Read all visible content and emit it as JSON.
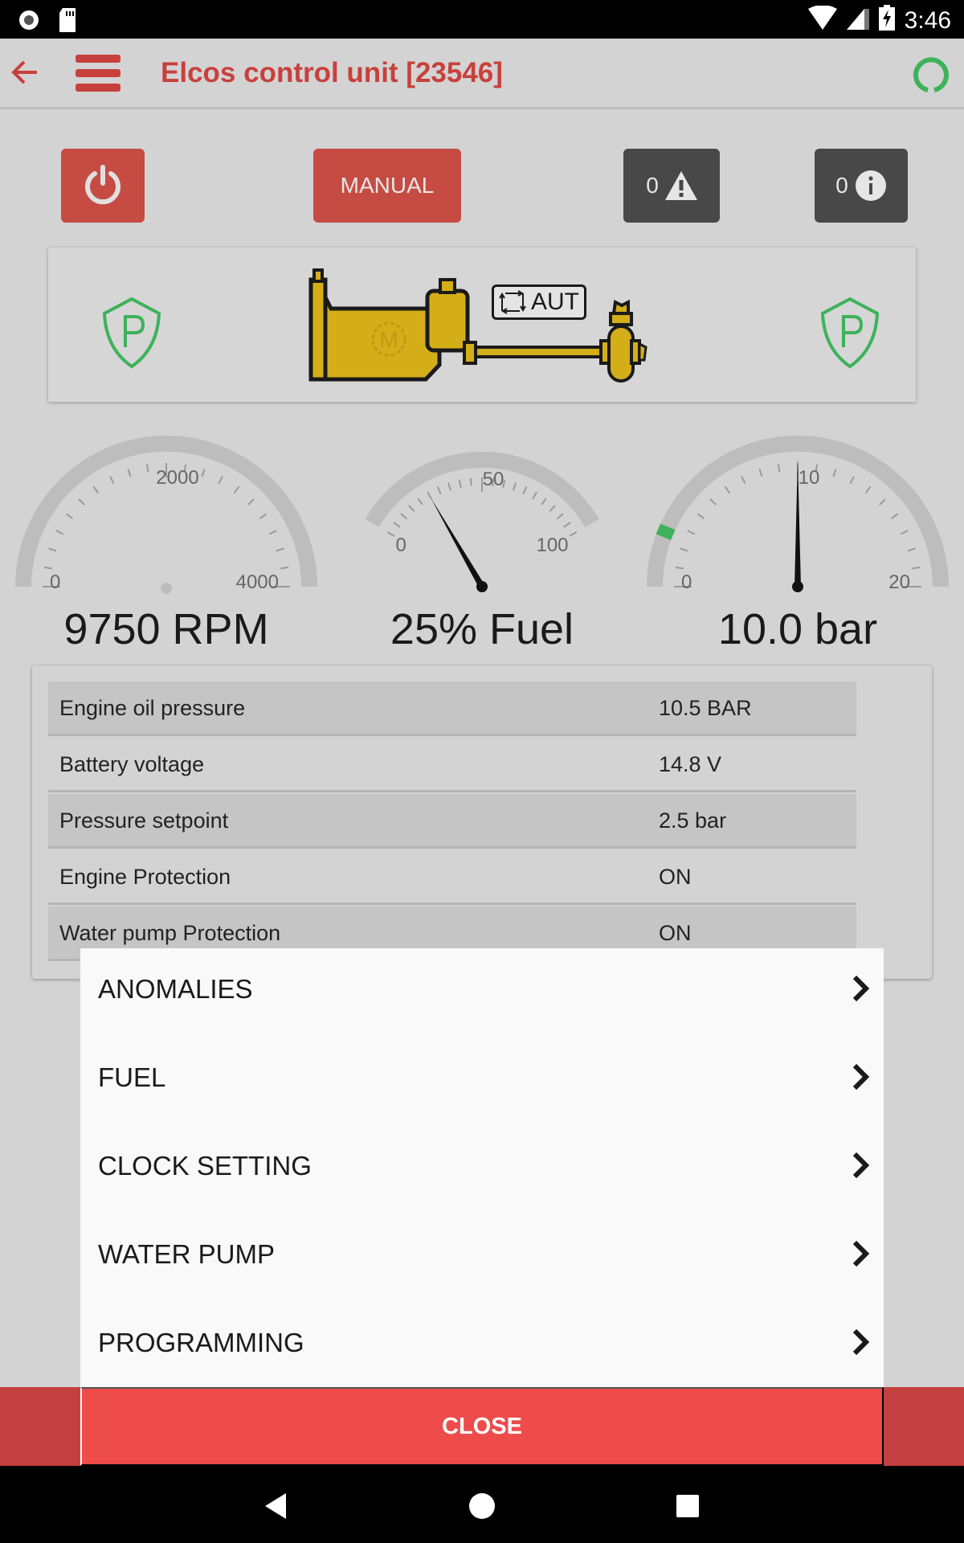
{
  "status_bar": {
    "time": "3:46",
    "icons": [
      "camera-icon",
      "sd-card-icon",
      "wifi-icon",
      "signal-icon",
      "battery-charging-icon"
    ]
  },
  "app_bar": {
    "back_icon": "arrow-left-icon",
    "menu_icon": "hamburger-menu-icon",
    "title": "Elcos control unit [23546]",
    "connection_icon": "connection-status-ring-icon",
    "accent": "#c8403c",
    "connection_color": "#3db25a"
  },
  "controls": {
    "power_icon": "power-icon",
    "mode_label": "MANUAL",
    "alarm_count": "0",
    "alarm_icon": "warning-icon",
    "info_count": "0",
    "info_icon": "info-icon",
    "button_red": "#c64c43",
    "button_dark": "#484848"
  },
  "schema": {
    "left_protection_icon": "shield-p-icon",
    "right_protection_icon": "shield-p-icon",
    "engine_icon": "engine-pump-icon",
    "engine_letter": "M",
    "auto_label": "AUT",
    "auto_icon": "auto-cycle-icon",
    "shield_color": "#3db25a",
    "engine_color": "#d4ae18"
  },
  "gauges": [
    {
      "name": "rpm",
      "min": 0,
      "max": 4000,
      "tick_labels": [
        "0",
        "2000",
        "4000"
      ],
      "value": 9750,
      "needle_visible": false,
      "readout": "9750 RPM",
      "sweep": "half"
    },
    {
      "name": "fuel",
      "min": 0,
      "max": 100,
      "tick_labels": [
        "0",
        "50",
        "100"
      ],
      "value": 25,
      "needle_visible": true,
      "readout": "25% Fuel",
      "sweep": "partial"
    },
    {
      "name": "pressure",
      "min": 0,
      "max": 20,
      "tick_labels": [
        "0",
        "10",
        "20"
      ],
      "value": 10.0,
      "needle_visible": true,
      "marker": 2.5,
      "marker_color": "#3db25a",
      "readout": "10.0 bar",
      "sweep": "half"
    }
  ],
  "table": {
    "rows": [
      {
        "label": "Engine oil pressure",
        "value": "10.5 BAR"
      },
      {
        "label": "Battery voltage",
        "value": "14.8 V"
      },
      {
        "label": "Pressure setpoint",
        "value": "2.5 bar"
      },
      {
        "label": "Engine Protection",
        "value": "ON"
      },
      {
        "label": "Water pump Protection",
        "value": "ON"
      }
    ]
  },
  "sheet": {
    "items": [
      {
        "label": "ANOMALIES"
      },
      {
        "label": "FUEL"
      },
      {
        "label": "CLOCK SETTING"
      },
      {
        "label": "WATER PUMP"
      },
      {
        "label": "PROGRAMMING"
      }
    ],
    "chevron_icon": "chevron-right-icon",
    "close_label": "CLOSE",
    "close_color": "#ee4b4b"
  },
  "nav_bar": {
    "back_icon": "nav-back-icon",
    "home_icon": "nav-home-icon",
    "recents_icon": "nav-recents-icon"
  }
}
